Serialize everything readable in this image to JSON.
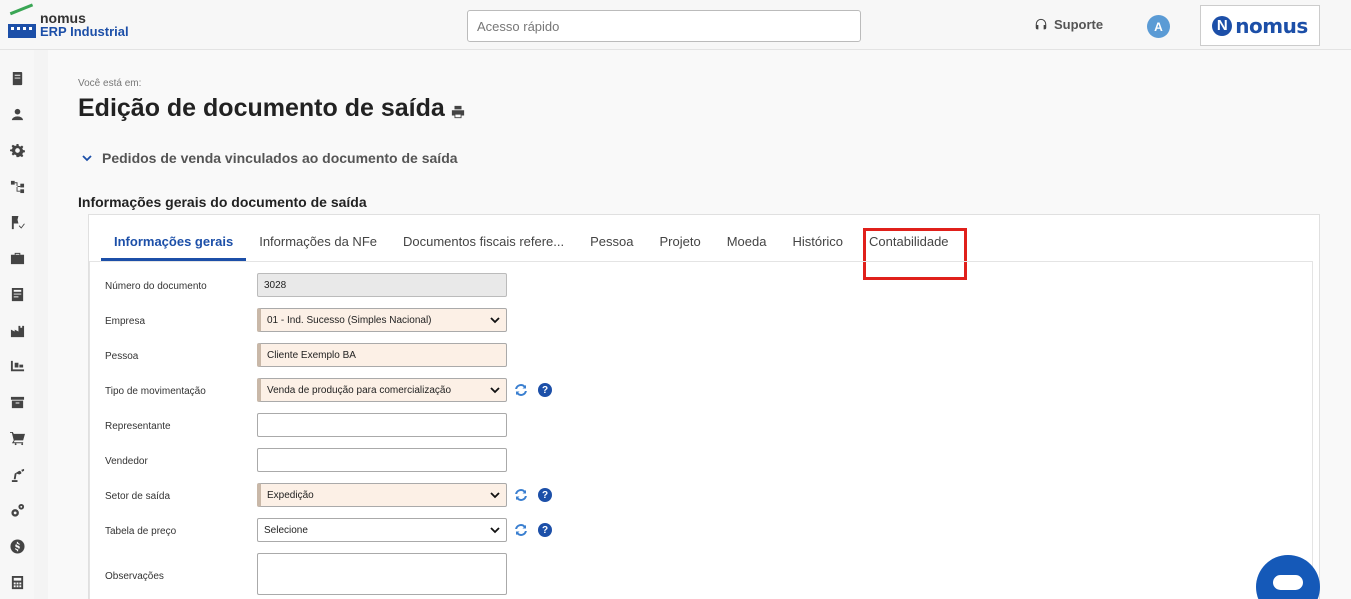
{
  "header": {
    "logo_line1": "nomus",
    "logo_line2": "ERP Industrial",
    "quick_access_placeholder": "Acesso rápido",
    "support_label": "Suporte",
    "avatar_initial": "A",
    "brand_name": "nomus"
  },
  "sidebar": {
    "icons": [
      "book-icon",
      "user-icon",
      "gear-icon",
      "flow-icon",
      "flag-check-icon",
      "briefcase-icon",
      "ledger-icon",
      "factory-icon",
      "pallet-icon",
      "archive-icon",
      "cart-icon",
      "robot-arm-icon",
      "gears-icon",
      "dollar-icon",
      "calculator-icon"
    ]
  },
  "page": {
    "breadcrumb_label": "Você está em:",
    "title": "Edição de documento de saída",
    "collapse_section": "Pedidos de venda vinculados ao documento de saída",
    "section_title": "Informações gerais do documento de saída"
  },
  "tabs": [
    {
      "label": "Informações gerais",
      "active": true
    },
    {
      "label": "Informações da NFe"
    },
    {
      "label": "Documentos fiscais refere..."
    },
    {
      "label": "Pessoa"
    },
    {
      "label": "Projeto"
    },
    {
      "label": "Moeda"
    },
    {
      "label": "Histórico"
    },
    {
      "label": "Contabilidade"
    }
  ],
  "form": {
    "numero_label": "Número do documento",
    "numero_value": "3028",
    "empresa_label": "Empresa",
    "empresa_value": "01 - Ind. Sucesso (Simples Nacional)",
    "pessoa_label": "Pessoa",
    "pessoa_value": "Cliente Exemplo BA",
    "tipo_label": "Tipo de movimentação",
    "tipo_value": "Venda de produção para comercialização",
    "representante_label": "Representante",
    "representante_value": "",
    "vendedor_label": "Vendedor",
    "vendedor_value": "",
    "setor_label": "Setor de saída",
    "setor_value": "Expedição",
    "tabela_label": "Tabela de preço",
    "tabela_value": "Selecione",
    "observacoes_label": "Observações",
    "observacoes_value": "",
    "help_glyph": "?"
  },
  "colors": {
    "primary": "#1c4fa8",
    "highlight": "#e0201b",
    "required_bg": "#fcf0e6"
  }
}
